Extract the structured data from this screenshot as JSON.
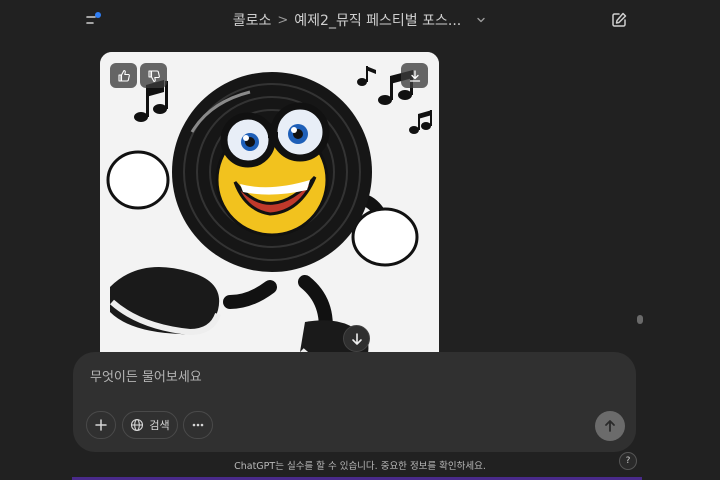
{
  "header": {
    "breadcrumb_project": "콜로소",
    "breadcrumb_separator": ">",
    "chat_title": "예제2_뮤직 페스티벌 포스...",
    "title_dropdown_icon": "chevron-down-icon",
    "sidebar_icon": "sidebar-toggle-icon",
    "new_chat_icon": "edit-icon",
    "notification_color": "#2f7ef5"
  },
  "image_card": {
    "like_icon": "thumbs-up-icon",
    "dislike_icon": "thumbs-down-icon",
    "download_icon": "download-icon"
  },
  "composer": {
    "placeholder": "무엇이든 물어보세요",
    "attach_icon": "plus-icon",
    "search_label": "검색",
    "search_icon": "globe-icon",
    "more_icon": "more-icon",
    "send_icon": "arrow-up-icon"
  },
  "footer": {
    "disclaimer": "ChatGPT는 실수를 할 수 있습니다. 중요한 정보를 확인하세요.",
    "help_label": "?"
  }
}
